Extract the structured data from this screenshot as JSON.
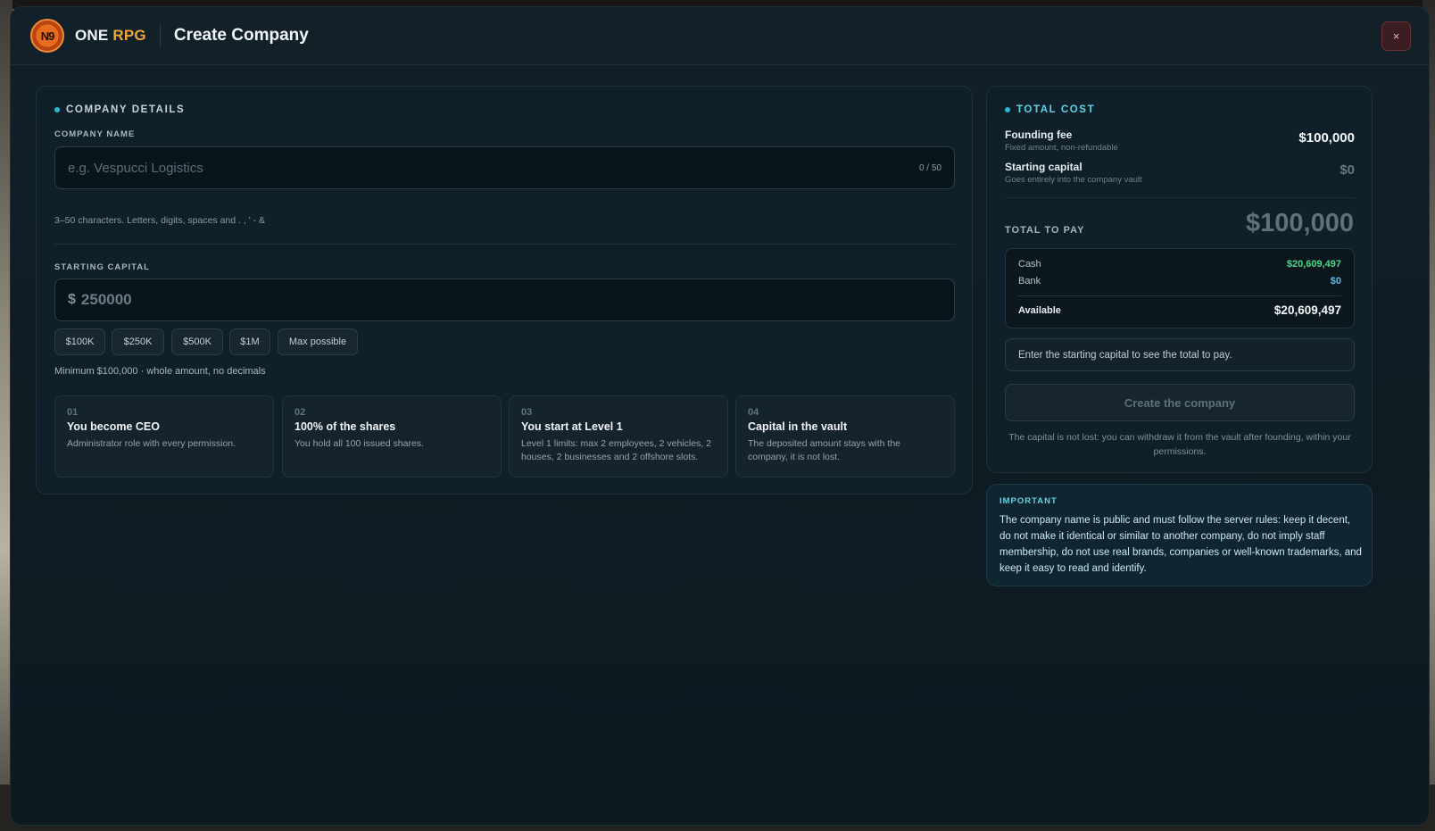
{
  "header": {
    "logo_text": "N9",
    "brand_primary": "ONE",
    "brand_accent": "RPG",
    "title": "Create Company",
    "close_symbol": "×"
  },
  "company_details": {
    "section_title": "COMPANY DETAILS",
    "name_label": "COMPANY NAME",
    "name_placeholder": "e.g. Vespucci Logistics",
    "name_counter": "0 / 50",
    "name_hint": "3–50 characters. Letters, digits, spaces and . , ' - &",
    "capital_label": "STARTING CAPITAL",
    "currency_symbol": "$",
    "capital_placeholder": "250000",
    "chips": [
      "$100K",
      "$250K",
      "$500K",
      "$1M",
      "Max possible"
    ],
    "capital_hint": "Minimum $100,000 · whole amount, no decimals"
  },
  "steps": [
    {
      "num": "01",
      "title": "You become CEO",
      "desc": "Administrator role with every permission."
    },
    {
      "num": "02",
      "title": "100% of the shares",
      "desc": "You hold all 100 issued shares."
    },
    {
      "num": "03",
      "title": "You start at Level 1",
      "desc": "Level 1 limits: max 2 employees, 2 vehicles, 2 houses, 2 businesses and 2 offshore slots."
    },
    {
      "num": "04",
      "title": "Capital in the vault",
      "desc": "The deposited amount stays with the company, it is not lost."
    }
  ],
  "total_cost": {
    "section_title": "TOTAL COST",
    "founding_label": "Founding fee",
    "founding_sub": "Fixed amount, non-refundable",
    "founding_value": "$100,000",
    "capital_label": "Starting capital",
    "capital_sub": "Goes entirely into the company vault",
    "capital_value": "$0",
    "total_label": "TOTAL TO PAY",
    "total_value": "$100,000",
    "cash_label": "Cash",
    "cash_value": "$20,609,497",
    "bank_label": "Bank",
    "bank_value": "$0",
    "available_label": "Available",
    "available_value": "$20,609,497",
    "notice": "Enter the starting capital to see the total to pay.",
    "create_button": "Create the company",
    "foot_note": "The capital is not lost: you can withdraw it from the vault after founding, within your permissions."
  },
  "important": {
    "title": "IMPORTANT",
    "text": "The company name is public and must follow the server rules: keep it decent, do not make it identical or similar to another company, do not imply staff membership, do not use real brands, companies or well-known trademarks, and keep it easy to read and identify."
  },
  "colors": {
    "accent": "#2ab6d6",
    "brand_accent": "#f0a43a",
    "cash_green": "#4fd68a",
    "bank_blue": "#5fb8f0"
  }
}
